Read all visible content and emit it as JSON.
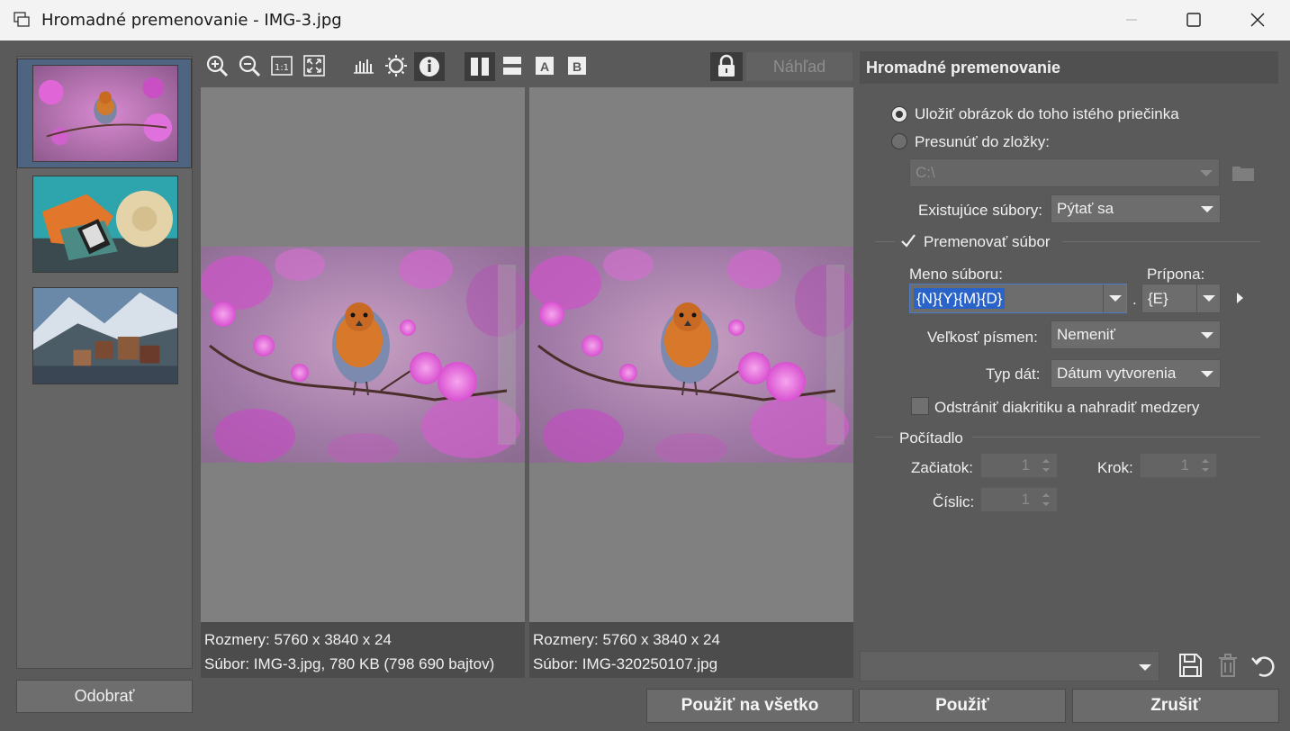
{
  "window": {
    "title": "Hromadné premenovanie - IMG-3.jpg",
    "controls": [
      "minimize",
      "maximize",
      "close"
    ]
  },
  "sidebar": {
    "thumbnails": [
      {
        "name": "robin-on-blossoms",
        "selected": true
      },
      {
        "name": "beach-hat-reader",
        "selected": false
      },
      {
        "name": "mountain-village",
        "selected": false
      }
    ],
    "remove_label": "Odobrať"
  },
  "toolbar": {
    "zoom_fit_label": "1:1",
    "ab_labels": [
      "A",
      "B"
    ],
    "preview_label": "Náhľad"
  },
  "preview": {
    "left": {
      "dimensions": "Rozmery: 5760 x 3840 x 24",
      "file": "Súbor: IMG-3.jpg, 780 KB (798 690 bajtov)"
    },
    "right": {
      "dimensions": "Rozmery: 5760 x 3840 x 24",
      "file": "Súbor: IMG-320250107.jpg"
    }
  },
  "panel": {
    "title": "Hromadné premenovanie",
    "save_same_folder_label": "Uložiť obrázok do toho istého priečinka",
    "move_to_folder_label": "Presunúť do zložky:",
    "folder_path": "C:\\",
    "existing_files_label": "Existujúce súbory:",
    "existing_files_value": "Pýtať sa",
    "rename_label": "Premenovať súbor",
    "rename_checked": true,
    "filename_label": "Meno súboru:",
    "filename_value": "{N}{Y}{M}{D}",
    "extension_label": "Prípona:",
    "extension_dot": ".",
    "extension_value": "{E}",
    "case_label": "Veľkosť písmen:",
    "case_value": "Nemeniť",
    "date_type_label": "Typ dát:",
    "date_type_value": "Dátum vytvorenia",
    "diacritics_label": "Odstrániť diakritiku a nahradiť medzery",
    "diacritics_checked": false,
    "counter_label": "Počítadlo",
    "start_label": "Začiatok:",
    "start_value": "1",
    "step_label": "Krok:",
    "step_value": "1",
    "digits_label": "Číslic:",
    "digits_value": "1"
  },
  "footer": {
    "preset_value": "",
    "apply_all_label": "Použiť na všetko",
    "apply_label": "Použiť",
    "cancel_label": "Zrušiť"
  },
  "colors": {
    "background": "#5a5a5a",
    "titlebar": "#f3f3f3",
    "selection": "#2a63c9",
    "thumb_selected": "#4f6480"
  }
}
